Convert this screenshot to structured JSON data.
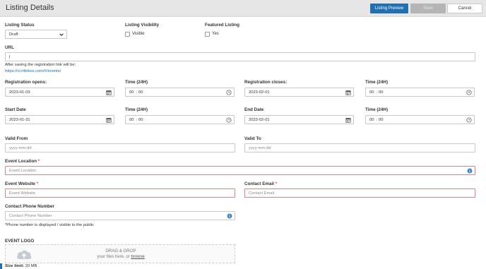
{
  "header": {
    "title": "Listing Details",
    "preview_label": "Listing Preview",
    "save_label": "Save",
    "cancel_label": "Cancel"
  },
  "listing_status": {
    "label": "Listing Status",
    "value": "Draft"
  },
  "listing_visibility": {
    "label": "Listing Visibility",
    "option": "Visible",
    "checked": false
  },
  "featured_listing": {
    "label": "Featured Listing",
    "option": "Yes",
    "checked": false
  },
  "url": {
    "label": "URL",
    "value": "|",
    "helper": "After saving the registration link will be:",
    "link": "https://ccntbikes.com/#/events/"
  },
  "registration_opens": {
    "label": "Registration opens:",
    "date": "2023-01-03",
    "time_label": "Time (24H)",
    "hh": "00",
    "mm": "00"
  },
  "registration_closes": {
    "label": "Registration closes:",
    "date": "2023-02-01",
    "time_label": "Time (24H)",
    "hh": "00",
    "mm": "00"
  },
  "start_date": {
    "label": "Start Date",
    "date": "2023-01-31",
    "time_label": "Time (24H)",
    "hh": "00",
    "mm": "00"
  },
  "end_date": {
    "label": "End Date",
    "date": "2023-02-01",
    "time_label": "Time (24H)",
    "hh": "00",
    "mm": "00"
  },
  "valid_from": {
    "label": "Valid From",
    "placeholder": "yyyy-mm-dd"
  },
  "valid_to": {
    "label": "Valid To",
    "placeholder": "yyyy-mm-dd"
  },
  "event_location": {
    "label": "Event Location",
    "required": "*",
    "placeholder": "Event Location"
  },
  "event_website": {
    "label": "Event Website",
    "required": "*",
    "placeholder": "Event Website"
  },
  "contact_email": {
    "label": "Contact Email",
    "required": "*",
    "placeholder": "Contact Email"
  },
  "contact_phone": {
    "label": "Contact Phone Number",
    "placeholder": "Contact Phone Number",
    "note": "*Phone number is displayed / visible to the public"
  },
  "event_logo": {
    "label": "EVENT LOGO",
    "drop_title": "DRAG & DROP",
    "drop_sub_before": "your files here, or ",
    "browse": "browse",
    "size_label": "Size limit:",
    "size_value": "20 MB"
  },
  "colors": {
    "accent": "#1f6fb2",
    "error_border": "#e0828a",
    "info_icon": "#3b7fc4"
  },
  "icons": [
    "calendar-icon",
    "clock-icon",
    "info-icon",
    "chevron-down-icon",
    "cloud-upload-icon"
  ]
}
